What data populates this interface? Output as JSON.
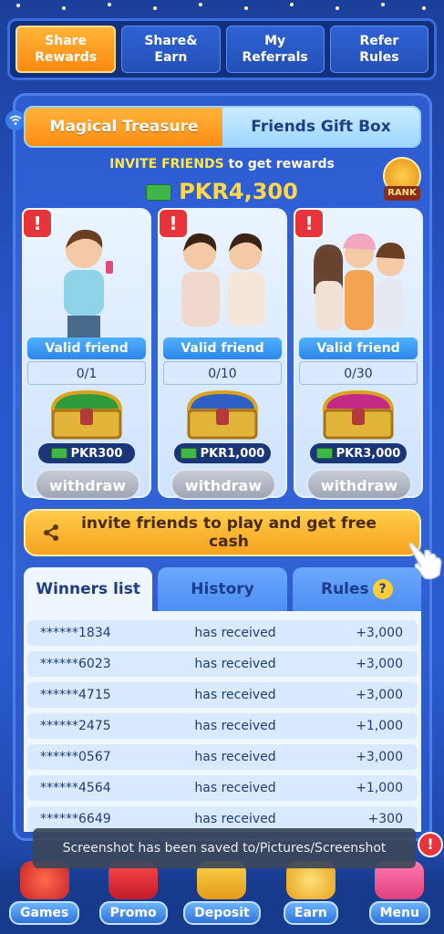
{
  "top_tabs": [
    "Share\nRewards",
    "Share&\nEarn",
    "My\nReferrals",
    "Refer\nRules"
  ],
  "segment": {
    "left": "Magical Treasure",
    "right": "Friends Gift Box"
  },
  "invite": {
    "highlight": "INVITE FRIENDS",
    "rest": " to get  rewards"
  },
  "total_amount": "PKR4,300",
  "rank_label": "RANK",
  "cards": [
    {
      "alert": "!",
      "label": "Valid friend",
      "progress": "0/1",
      "reward": "PKR300",
      "button": "withdraw"
    },
    {
      "alert": "!",
      "label": "Valid friend",
      "progress": "0/10",
      "reward": "PKR1,000",
      "button": "withdraw"
    },
    {
      "alert": "!",
      "label": "Valid friend",
      "progress": "0/30",
      "reward": "PKR3,000",
      "button": "withdraw"
    }
  ],
  "invite_button": "invite friends to play and get free cash",
  "list_tabs": {
    "winners": "Winners list",
    "history": "History",
    "rules": "Rules",
    "rules_icon": "?"
  },
  "winners": [
    {
      "id": "******1834",
      "status": "has received",
      "amount": "+3,000"
    },
    {
      "id": "******6023",
      "status": "has received",
      "amount": "+3,000"
    },
    {
      "id": "******4715",
      "status": "has received",
      "amount": "+3,000"
    },
    {
      "id": "******2475",
      "status": "has received",
      "amount": "+1,000"
    },
    {
      "id": "******0567",
      "status": "has received",
      "amount": "+3,000"
    },
    {
      "id": "******4564",
      "status": "has received",
      "amount": "+1,000"
    },
    {
      "id": "******6649",
      "status": "has received",
      "amount": "+300"
    }
  ],
  "toast": "Screenshot has been saved to/Pictures/Screenshot",
  "toast_alert": "!",
  "bottom_nav": [
    "Games",
    "Promo",
    "Deposit",
    "Earn",
    "Menu"
  ],
  "colors": {
    "accent": "#ff9a1f",
    "panel": "#2d5bd0",
    "alert": "#e6343a"
  }
}
